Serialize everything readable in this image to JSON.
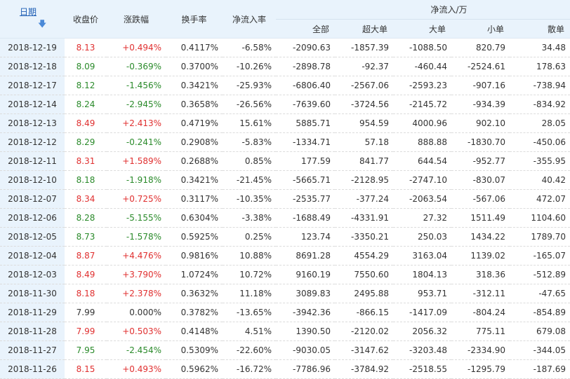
{
  "header": {
    "date": "日期",
    "close": "收盘价",
    "change": "涨跌幅",
    "turnover": "换手率",
    "net_ratio": "净流入率",
    "net_flow": "净流入/万",
    "all": "全部",
    "super": "超大单",
    "large": "大单",
    "small": "小单",
    "retail": "散单"
  },
  "rows": [
    {
      "date": "2018-12-19",
      "close": "8.13",
      "change": "+0.494%",
      "turnover": "0.4117%",
      "net_ratio": "-6.58%",
      "all": "-2090.63",
      "super": "-1857.39",
      "large": "-1088.50",
      "small": "820.79",
      "retail": "34.48",
      "dir": "up"
    },
    {
      "date": "2018-12-18",
      "close": "8.09",
      "change": "-0.369%",
      "turnover": "0.3700%",
      "net_ratio": "-10.26%",
      "all": "-2898.78",
      "super": "-92.37",
      "large": "-460.44",
      "small": "-2524.61",
      "retail": "178.63",
      "dir": "down"
    },
    {
      "date": "2018-12-17",
      "close": "8.12",
      "change": "-1.456%",
      "turnover": "0.3421%",
      "net_ratio": "-25.93%",
      "all": "-6806.40",
      "super": "-2567.06",
      "large": "-2593.23",
      "small": "-907.16",
      "retail": "-738.94",
      "dir": "down"
    },
    {
      "date": "2018-12-14",
      "close": "8.24",
      "change": "-2.945%",
      "turnover": "0.3658%",
      "net_ratio": "-26.56%",
      "all": "-7639.60",
      "super": "-3724.56",
      "large": "-2145.72",
      "small": "-934.39",
      "retail": "-834.92",
      "dir": "down"
    },
    {
      "date": "2018-12-13",
      "close": "8.49",
      "change": "+2.413%",
      "turnover": "0.4719%",
      "net_ratio": "15.61%",
      "all": "5885.71",
      "super": "954.59",
      "large": "4000.96",
      "small": "902.10",
      "retail": "28.05",
      "dir": "up"
    },
    {
      "date": "2018-12-12",
      "close": "8.29",
      "change": "-0.241%",
      "turnover": "0.2908%",
      "net_ratio": "-5.83%",
      "all": "-1334.71",
      "super": "57.18",
      "large": "888.88",
      "small": "-1830.70",
      "retail": "-450.06",
      "dir": "down"
    },
    {
      "date": "2018-12-11",
      "close": "8.31",
      "change": "+1.589%",
      "turnover": "0.2688%",
      "net_ratio": "0.85%",
      "all": "177.59",
      "super": "841.77",
      "large": "644.54",
      "small": "-952.77",
      "retail": "-355.95",
      "dir": "up"
    },
    {
      "date": "2018-12-10",
      "close": "8.18",
      "change": "-1.918%",
      "turnover": "0.3421%",
      "net_ratio": "-21.45%",
      "all": "-5665.71",
      "super": "-2128.95",
      "large": "-2747.10",
      "small": "-830.07",
      "retail": "40.42",
      "dir": "down"
    },
    {
      "date": "2018-12-07",
      "close": "8.34",
      "change": "+0.725%",
      "turnover": "0.3117%",
      "net_ratio": "-10.35%",
      "all": "-2535.77",
      "super": "-377.24",
      "large": "-2063.54",
      "small": "-567.06",
      "retail": "472.07",
      "dir": "up"
    },
    {
      "date": "2018-12-06",
      "close": "8.28",
      "change": "-5.155%",
      "turnover": "0.6304%",
      "net_ratio": "-3.38%",
      "all": "-1688.49",
      "super": "-4331.91",
      "large": "27.32",
      "small": "1511.49",
      "retail": "1104.60",
      "dir": "down"
    },
    {
      "date": "2018-12-05",
      "close": "8.73",
      "change": "-1.578%",
      "turnover": "0.5925%",
      "net_ratio": "0.25%",
      "all": "123.74",
      "super": "-3350.21",
      "large": "250.03",
      "small": "1434.22",
      "retail": "1789.70",
      "dir": "down"
    },
    {
      "date": "2018-12-04",
      "close": "8.87",
      "change": "+4.476%",
      "turnover": "0.9816%",
      "net_ratio": "10.88%",
      "all": "8691.28",
      "super": "4554.29",
      "large": "3163.04",
      "small": "1139.02",
      "retail": "-165.07",
      "dir": "up"
    },
    {
      "date": "2018-12-03",
      "close": "8.49",
      "change": "+3.790%",
      "turnover": "1.0724%",
      "net_ratio": "10.72%",
      "all": "9160.19",
      "super": "7550.60",
      "large": "1804.13",
      "small": "318.36",
      "retail": "-512.89",
      "dir": "up"
    },
    {
      "date": "2018-11-30",
      "close": "8.18",
      "change": "+2.378%",
      "turnover": "0.3632%",
      "net_ratio": "11.18%",
      "all": "3089.83",
      "super": "2495.88",
      "large": "953.71",
      "small": "-312.11",
      "retail": "-47.65",
      "dir": "up"
    },
    {
      "date": "2018-11-29",
      "close": "7.99",
      "change": "0.000%",
      "turnover": "0.3782%",
      "net_ratio": "-13.65%",
      "all": "-3942.36",
      "super": "-866.15",
      "large": "-1417.09",
      "small": "-804.24",
      "retail": "-854.89",
      "dir": "flat"
    },
    {
      "date": "2018-11-28",
      "close": "7.99",
      "change": "+0.503%",
      "turnover": "0.4148%",
      "net_ratio": "4.51%",
      "all": "1390.50",
      "super": "-2120.02",
      "large": "2056.32",
      "small": "775.11",
      "retail": "679.08",
      "dir": "up"
    },
    {
      "date": "2018-11-27",
      "close": "7.95",
      "change": "-2.454%",
      "turnover": "0.5309%",
      "net_ratio": "-22.60%",
      "all": "-9030.05",
      "super": "-3147.62",
      "large": "-3203.48",
      "small": "-2334.90",
      "retail": "-344.05",
      "dir": "down"
    },
    {
      "date": "2018-11-26",
      "close": "8.15",
      "change": "+0.493%",
      "turnover": "0.5962%",
      "net_ratio": "-16.72%",
      "all": "-7786.96",
      "super": "-3784.92",
      "large": "-2518.55",
      "small": "-1295.79",
      "retail": "-187.69",
      "dir": "up"
    }
  ],
  "colors": {
    "up": "#e03030",
    "down": "#2a8a2a",
    "flat": "#333333",
    "header_bg": "#e9f3fc",
    "link": "#1f5fb5"
  }
}
